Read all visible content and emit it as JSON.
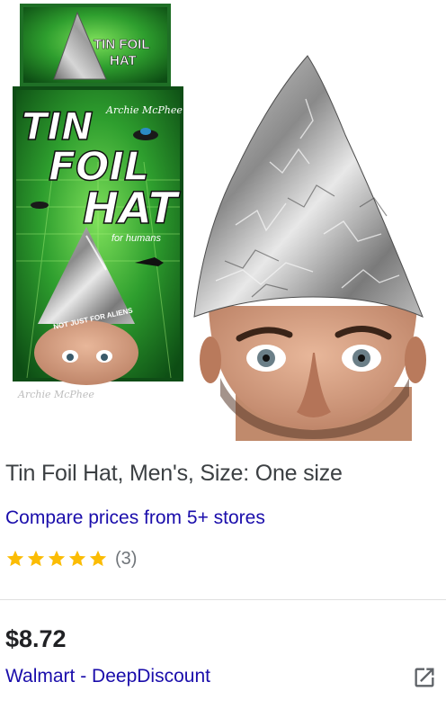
{
  "product": {
    "title": "Tin Foil Hat, Men's, Size: One size",
    "compare_label": "Compare prices from 5+ stores",
    "rating_count": "(3)",
    "rating_stars": 5,
    "price": "$8.72",
    "seller": "Walmart - DeepDiscount",
    "external_link_icon": "open-in-new-icon"
  },
  "package": {
    "top_label_line1": "TIN FOIL",
    "top_label_line2": "HAT",
    "tin": "TIN",
    "foil": "FOIL",
    "hat": "HAT",
    "for_humans": "for humans",
    "brand": "Archie McPhee",
    "bottom_brand": "Archie McPhee",
    "slogan": "NOT JUST FOR ALIENS"
  },
  "colors": {
    "title": "#3c4043",
    "link": "#1a0dab",
    "star": "#fbbc04",
    "price": "#202124",
    "muted": "#70757a",
    "package_green": "#2e8b2e"
  }
}
